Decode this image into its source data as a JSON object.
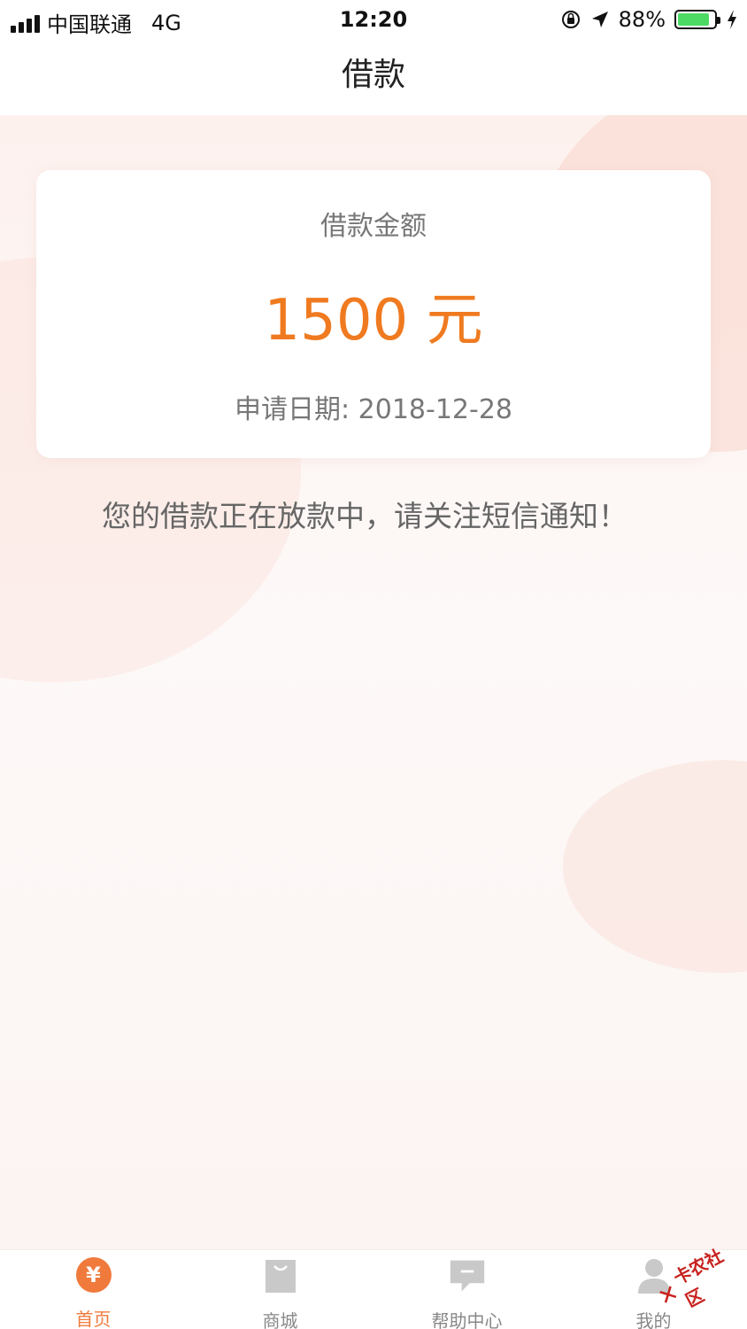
{
  "status_bar": {
    "carrier": "中国联通",
    "network": "4G",
    "time": "12:20",
    "battery_percent": "88%",
    "battery_level": 0.88,
    "icons": [
      "signal-icon",
      "orientation-lock-icon",
      "location-arrow-icon",
      "battery-icon",
      "charging-bolt-icon"
    ]
  },
  "header": {
    "title": "借款"
  },
  "card": {
    "label": "借款金额",
    "amount": "1500 元",
    "date": "申请日期: 2018-12-28"
  },
  "notice": "您的借款正在放款中，请关注短信通知！",
  "tab_bar": {
    "items": [
      {
        "label": "首页",
        "icon": "yen-icon",
        "active": true
      },
      {
        "label": "商城",
        "icon": "shopping-bag-icon",
        "active": false
      },
      {
        "label": "帮助中心",
        "icon": "chat-bubble-icon",
        "active": false
      },
      {
        "label": "我的",
        "icon": "user-icon",
        "active": false
      }
    ]
  },
  "watermark": {
    "text": "卡农社区"
  },
  "colors": {
    "accent": "#f07a3c",
    "amount": "#f07a20",
    "battery": "#4cd964"
  }
}
